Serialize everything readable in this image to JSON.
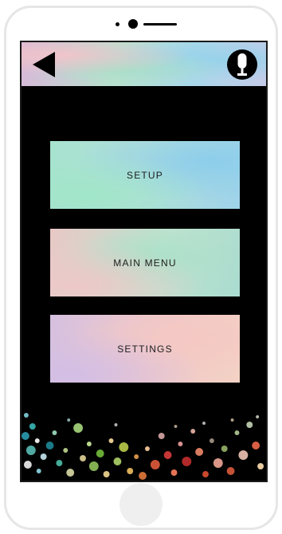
{
  "top_bar": {
    "back_icon": "back-arrow-icon",
    "mic_icon": "microphone-icon"
  },
  "menu": {
    "setup_label": "SETUP",
    "main_menu_label": "MAIN MENU",
    "settings_label": "SETTINGS"
  },
  "colors": {
    "screen_background": "#000000",
    "text": "#1c1c1c"
  }
}
